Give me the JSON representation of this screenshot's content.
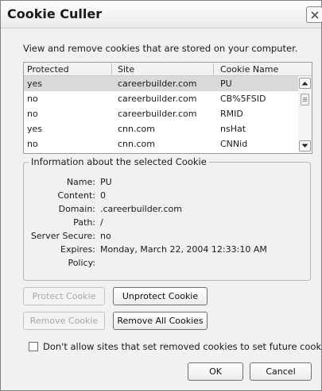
{
  "window": {
    "title": "Cookie Culler"
  },
  "intro_text": "View and remove cookies that are stored on your computer.",
  "table": {
    "columns": [
      "Protected",
      "Site",
      "Cookie Name"
    ],
    "rows": [
      {
        "protected": "yes",
        "site": "careerbuilder.com",
        "cookie": "PU"
      },
      {
        "protected": "no",
        "site": "careerbuilder.com",
        "cookie": "CB%5FSID"
      },
      {
        "protected": "no",
        "site": "careerbuilder.com",
        "cookie": "RMID"
      },
      {
        "protected": "yes",
        "site": "cnn.com",
        "cookie": "nsHat"
      },
      {
        "protected": "no",
        "site": "cnn.com",
        "cookie": "CNNid"
      }
    ]
  },
  "info": {
    "legend": "Information about the selected Cookie",
    "fields": [
      {
        "label": "Name:",
        "value": "PU"
      },
      {
        "label": "Content:",
        "value": "0"
      },
      {
        "label": "Domain:",
        "value": ".careerbuilder.com"
      },
      {
        "label": "Path:",
        "value": "/"
      },
      {
        "label": "Server Secure:",
        "value": "no"
      },
      {
        "label": "Expires:",
        "value": "Monday, March 22, 2004 12:33:10 AM"
      },
      {
        "label": "Policy:",
        "value": ""
      }
    ]
  },
  "buttons": {
    "protect": "Protect Cookie",
    "unprotect": "Unprotect Cookie",
    "remove": "Remove Cookie",
    "remove_all": "Remove All Cookies",
    "ok": "OK",
    "cancel": "Cancel"
  },
  "checkbox": {
    "label": "Don't allow sites that set removed cookies to set future cookies",
    "checked": false
  },
  "icons": {
    "close": "close-icon",
    "scroll_up": "scroll-up-icon",
    "scroll_down": "scroll-down-icon"
  },
  "colors": {
    "selected_row": "#d9d9d9",
    "background": "#f1f1f1"
  }
}
